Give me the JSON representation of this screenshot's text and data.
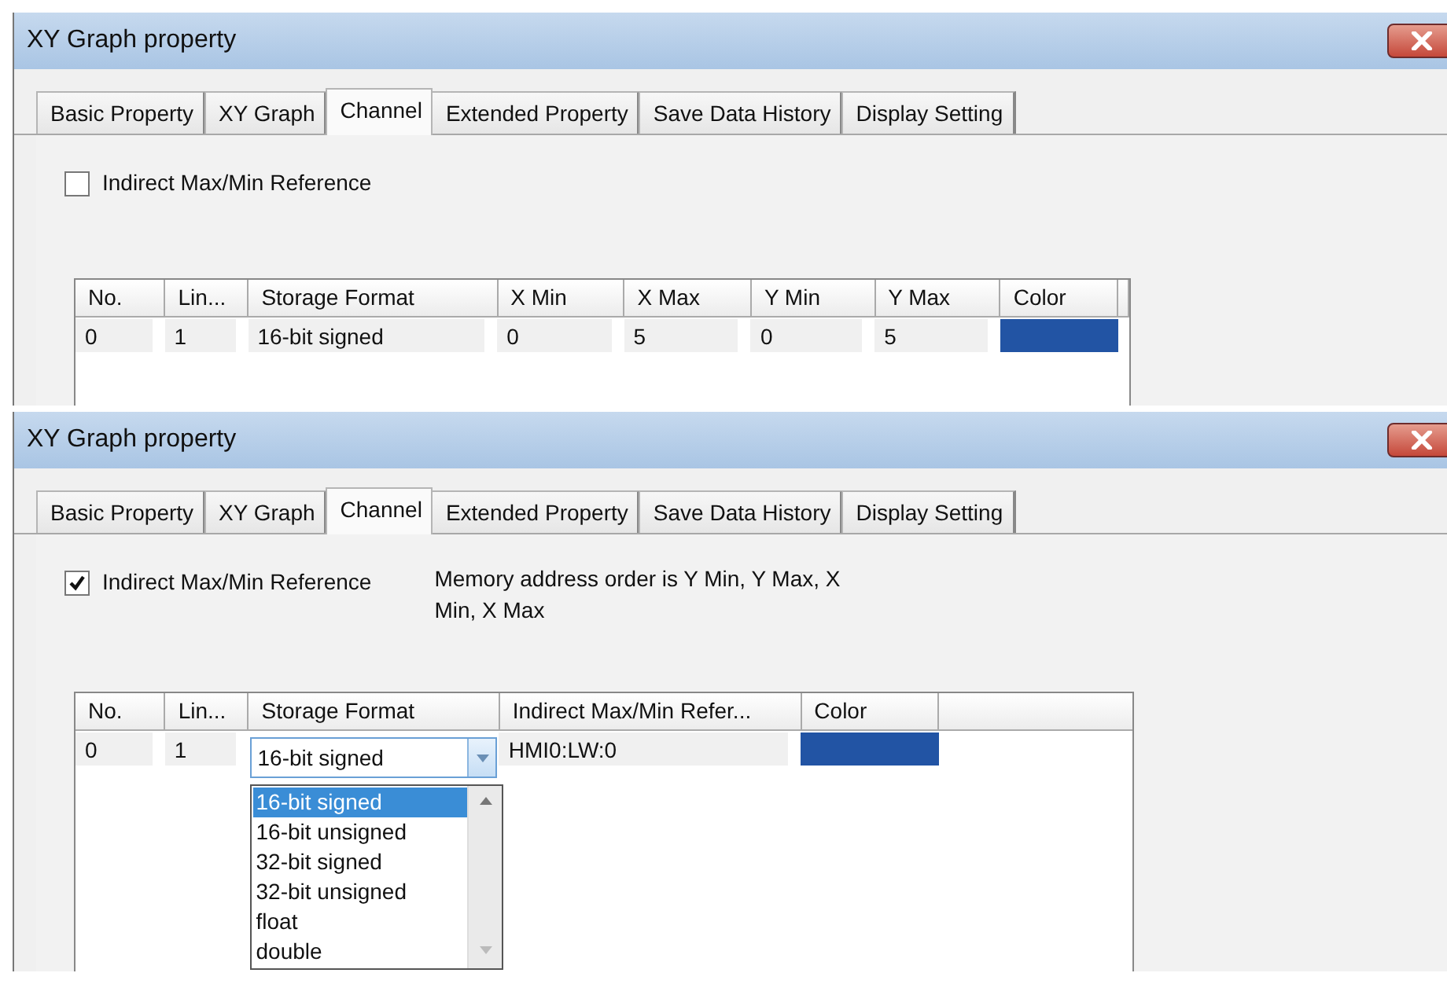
{
  "dialogs": [
    {
      "title": "XY Graph property",
      "tabs": [
        {
          "label": "Basic Property",
          "selected": false
        },
        {
          "label": "XY Graph",
          "selected": false
        },
        {
          "label": "Channel",
          "selected": true
        },
        {
          "label": "Extended Property",
          "selected": false
        },
        {
          "label": "Save Data History",
          "selected": false
        },
        {
          "label": "Display Setting",
          "selected": false
        }
      ],
      "indirect_reference": {
        "label": "Indirect Max/Min Reference",
        "checked": false
      },
      "table": {
        "columns": [
          "No.",
          "Lin...",
          "Storage Format",
          "X Min",
          "X Max",
          "Y Min",
          "Y Max",
          "Color"
        ],
        "rows": [
          {
            "cells": [
              {
                "kind": "text",
                "text": "0"
              },
              {
                "kind": "text",
                "text": "1"
              },
              {
                "kind": "text",
                "text": "16-bit signed"
              },
              {
                "kind": "text",
                "text": "0"
              },
              {
                "kind": "text",
                "text": "5"
              },
              {
                "kind": "text",
                "text": "0"
              },
              {
                "kind": "text",
                "text": "5"
              },
              {
                "kind": "color",
                "color": "#2254a4"
              }
            ]
          }
        ]
      }
    },
    {
      "title": "XY Graph property",
      "tabs": [
        {
          "label": "Basic Property",
          "selected": false
        },
        {
          "label": "XY Graph",
          "selected": false
        },
        {
          "label": "Channel",
          "selected": true
        },
        {
          "label": "Extended Property",
          "selected": false
        },
        {
          "label": "Save Data History",
          "selected": false
        },
        {
          "label": "Display Setting",
          "selected": false
        }
      ],
      "indirect_reference": {
        "label": "Indirect Max/Min Reference",
        "checked": true
      },
      "note": "Memory address order is Y Min, Y Max, X Min, X Max",
      "table": {
        "columns": [
          "No.",
          "Lin...",
          "Storage Format",
          "Indirect Max/Min Refer...",
          "Color"
        ],
        "rows": [
          {
            "cells": [
              {
                "kind": "text",
                "text": "0"
              },
              {
                "kind": "text",
                "text": "1"
              },
              {
                "kind": "combo",
                "text": "16-bit signed",
                "options": [
                  {
                    "label": "16-bit signed",
                    "selected": true
                  },
                  {
                    "label": "16-bit unsigned",
                    "selected": false
                  },
                  {
                    "label": "32-bit signed",
                    "selected": false
                  },
                  {
                    "label": "32-bit unsigned",
                    "selected": false
                  },
                  {
                    "label": "float",
                    "selected": false
                  },
                  {
                    "label": "double",
                    "selected": false
                  }
                ]
              },
              {
                "kind": "text",
                "text": "HMI0:LW:0"
              },
              {
                "kind": "color",
                "color": "#2254a4"
              }
            ]
          }
        ]
      }
    }
  ]
}
